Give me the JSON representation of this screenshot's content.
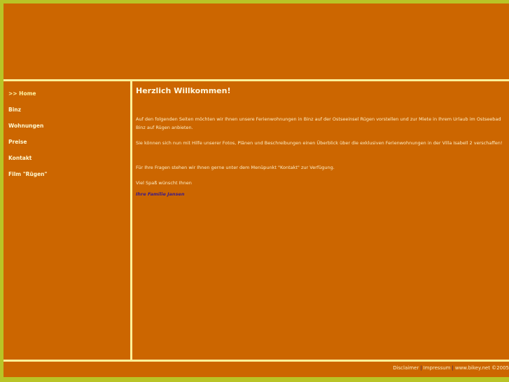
{
  "nav": {
    "items": [
      {
        "label": ">> Home"
      },
      {
        "label": "Binz"
      },
      {
        "label": "Wohnungen"
      },
      {
        "label": "Preise"
      },
      {
        "label": "Kontakt"
      },
      {
        "label": "Film \"Rügen\""
      }
    ]
  },
  "main": {
    "title": "Herzlich Willkommen!",
    "paragraphs": [
      "Auf den folgenden Seiten möchten wir Ihnen unsere Ferienwohnungen in Binz auf der Ostseeinsel Rügen vorstellen und zur Miete in Ihrem Urlaub im Ostseebad Binz auf Rügen anbieten.",
      "Sie können sich nun mit Hilfe unserer Fotos, Plänen und Beschreibungen einen Überblick über die exklusiven Ferienwohnungen in der Villa Isabell 2 verschaffen!",
      "Für Ihre Fragen stehen wir Ihnen gerne unter dem Menüpunkt \"Kontakt\" zur Verfügung.",
      "Viel Spaß wünscht Ihnen"
    ],
    "signature": "Ihre Familie Jansen"
  },
  "footer": {
    "disclaimer": "Disclaimer",
    "separator": "|",
    "impressum": "Impressum",
    "credit": "www.bikey.net ©2005"
  },
  "colors": {
    "background": "#cc6600",
    "outer_frame": "#b9c426",
    "divider": "#fdf099",
    "signature": "#3a1a8a"
  }
}
